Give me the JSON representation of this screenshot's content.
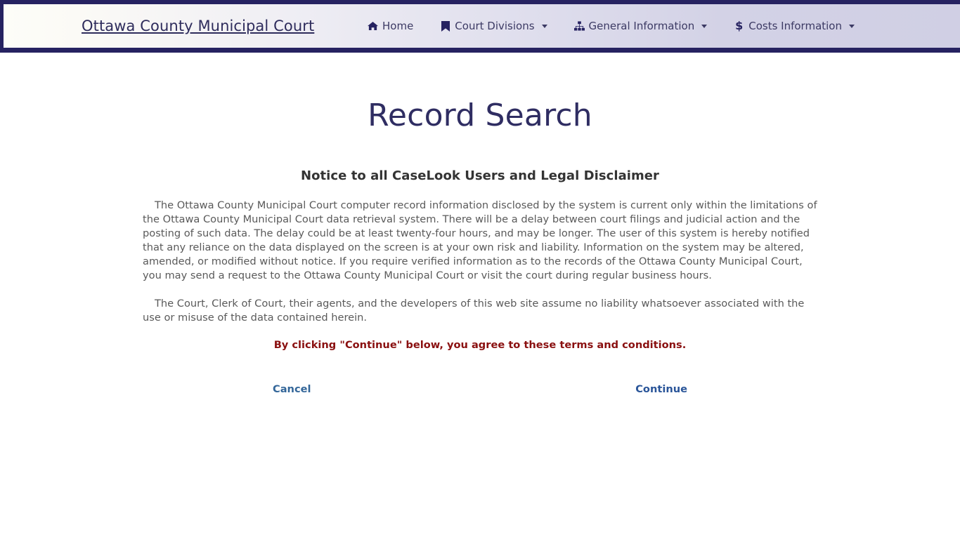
{
  "header": {
    "brand": "Ottawa County Municipal Court",
    "nav": [
      {
        "label": "Home",
        "icon": "home-icon",
        "has_caret": false
      },
      {
        "label": "Court Divisions",
        "icon": "bookmark-icon",
        "has_caret": true
      },
      {
        "label": "General Information",
        "icon": "sitemap-icon",
        "has_caret": true
      },
      {
        "label": "Costs Information",
        "icon": "dollar-icon",
        "has_caret": true
      }
    ]
  },
  "page": {
    "title": "Record Search",
    "notice_heading": "Notice to all CaseLook Users and Legal Disclaimer",
    "paragraph_1": "The Ottawa County Municipal Court computer record information disclosed by the system is current only within the limitations of the Ottawa County Municipal Court data retrieval system. There will be a delay between court filings and judicial action and the posting of such data. The delay could be at least twenty-four hours, and may be longer. The user of this system is hereby notified that any reliance on the data displayed on the screen is at your own risk and liability. Information on the system may be altered, amended, or modified without notice. If you require verified information as to the records of the Ottawa County Municipal Court, you may send a request to the Ottawa County Municipal Court or visit the court during regular business hours.",
    "paragraph_2": "The Court, Clerk of Court, their agents, and the developers of this web site assume no liability whatsoever associated with the use or misuse of the data contained herein.",
    "agree_text": "By clicking \"Continue\" below, you agree to these terms and conditions.",
    "cancel_label": "Cancel",
    "continue_label": "Continue"
  },
  "colors": {
    "navy_border": "#262261",
    "title": "#2f2d62",
    "heading": "#333333",
    "body": "#5a5a5a",
    "warning_red": "#8a1010",
    "link_blue": "#336699",
    "nav_gradient_left": "#fdfdf8",
    "nav_gradient_right": "#d0cfe4"
  }
}
